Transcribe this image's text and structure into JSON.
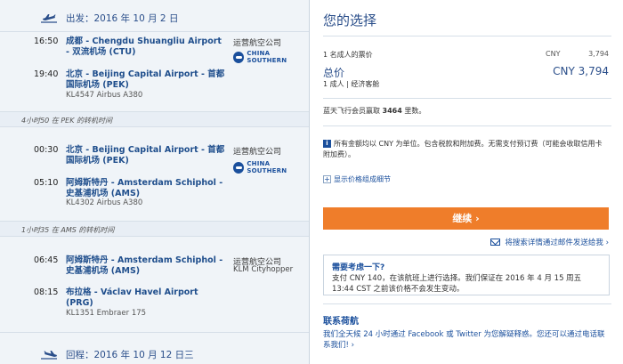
{
  "outbound": {
    "date_label": "出发：2016 年 10 月 2 日",
    "segments": [
      {
        "dep_time": "16:50",
        "dep_place": "成都 - Chengdu Shuangliu Airport - 双流机场 (CTU)",
        "arr_time": "19:40",
        "arr_place": "北京 - Beijing Capital Airport - 首都国际机场 (PEK)",
        "flight_info": "KL4547 Airbus A380",
        "operator_label": "运营航空公司",
        "operator_logo_text": "CHINA SOUTHERN"
      },
      {
        "dep_time": "00:30",
        "dep_place": "北京 - Beijing Capital Airport - 首都国际机场 (PEK)",
        "arr_time": "05:10",
        "arr_place": "阿姆斯特丹 - Amsterdam Schiphol - 史基浦机场 (AMS)",
        "flight_info": "KL4302 Airbus A380",
        "operator_label": "运营航空公司",
        "operator_logo_text": "CHINA SOUTHERN"
      },
      {
        "dep_time": "06:45",
        "dep_place": "阿姆斯特丹 - Amsterdam Schiphol - 史基浦机场 (AMS)",
        "arr_time": "08:15",
        "arr_place": "布拉格 - Václav Havel Airport (PRG)",
        "flight_info": "KL1351 Embraer 175",
        "operator_label": "运营航空公司",
        "operator_name": "KLM Cityhopper"
      }
    ],
    "layovers": [
      "4小时50 在 PEK 的转机时间",
      "1小时35 在 AMS 的转机时间"
    ]
  },
  "return": {
    "date_label": "回程：2016 年 10 月 12 日三"
  },
  "summary": {
    "title": "您的选择",
    "adult_ticket_label": "1 名成人的票价",
    "adult_ticket_currency": "CNY",
    "adult_ticket_amount": "3,794",
    "total_label": "总价",
    "total_value": "CNY 3,794",
    "pax_class": "1 成人 | 经济客舱",
    "miles_prefix": "蓝天飞行会员赢取 ",
    "miles_value": "3464",
    "miles_suffix": " 里数。",
    "notice": "所有金额均以 CNY 为单位。包含税款和附加费。无需支付预订费（可能会收取信用卡附加费）。",
    "price_detail_link": "显示价格组成细节",
    "continue_label": "继续 ›",
    "email_link": "将搜索详情通过邮件发送给我 ›",
    "hold_title": "需要考虑一下?",
    "hold_body": "支付 CNY 140，在该航班上进行选择。我们保证在 2016 年 4 月 15 周五 13:44 CST 之前该价格不会发生变动。",
    "contact_title": "联系荷航",
    "contact_text": "我们全天候 24 小时通过 Facebook 或 Twitter 为您解疑释惑。您还可以通过电话联系我们! ›"
  },
  "colors": {
    "brand_blue": "#1a4f9c",
    "continue_orange": "#ef7d2a",
    "panel_bg": "#f0f4f8"
  }
}
